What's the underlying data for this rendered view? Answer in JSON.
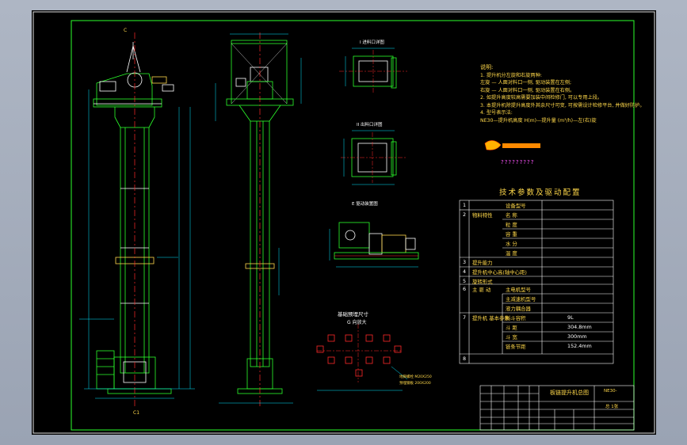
{
  "notes": {
    "title": "说明:",
    "lines": [
      "1. 提升机分左旋和右旋两种:",
      "   左旋 — 人面对料口一侧, 驱动装置在左侧;",
      "   右旋 — 人面对料口一侧, 驱动装置在右侧。",
      "2. 如提升高度较高需要加装中间检修门, 可以专用上段。",
      "3. 本提升机除提升高度外其余尺寸可变, 可按需设计检修平台, 并做好防护。",
      "4. 型号表示法:",
      "   NE30—提升机高度 H(m)—提升量 (m³/h)—左(右)旋"
    ]
  },
  "logo_caption": "?????????",
  "views": {
    "inlet": "I 进料口详图",
    "outlet": "II 出料口详图",
    "drive": "E 驱动装置图",
    "base_title": "基础预埋尺寸",
    "base_sub": "G 向放大",
    "anchor_1": "地脚螺栓 M20X250",
    "anchor_2": "预埋钢板 200X200",
    "section_1": "C",
    "section_2": "C1"
  },
  "param_table": {
    "title": "技术参数及驱动配置",
    "rows": [
      {
        "no": "1",
        "cat": "",
        "item": "设备型号",
        "value": ""
      },
      {
        "no": "2",
        "cat": "物料特性",
        "item": "名 称",
        "value": ""
      },
      {
        "no": "",
        "cat": "",
        "item": "粒 度",
        "value": ""
      },
      {
        "no": "",
        "cat": "",
        "item": "容 重",
        "value": ""
      },
      {
        "no": "",
        "cat": "",
        "item": "水 分",
        "value": ""
      },
      {
        "no": "",
        "cat": "",
        "item": "温 度",
        "value": ""
      },
      {
        "no": "3",
        "cat": "",
        "item": "提升能力",
        "value": ""
      },
      {
        "no": "4",
        "cat": "",
        "item": "提升机中心高(轴中心距)",
        "value": ""
      },
      {
        "no": "5",
        "cat": "",
        "item": "旋转形式",
        "value": ""
      },
      {
        "no": "6",
        "cat": "主 驱 动",
        "item": "主电机型号",
        "value": ""
      },
      {
        "no": "",
        "cat": "",
        "item": "主减速机型号",
        "value": ""
      },
      {
        "no": "",
        "cat": "",
        "item": "液力耦合器",
        "value": ""
      },
      {
        "no": "7",
        "cat": "提升机 基本参数",
        "item": "料斗容积",
        "value": "9L"
      },
      {
        "no": "",
        "cat": "",
        "item": "斗 距",
        "value": "304.8mm"
      },
      {
        "no": "",
        "cat": "",
        "item": "斗 宽",
        "value": "300mm"
      },
      {
        "no": "",
        "cat": "",
        "item": "链条节距",
        "value": "152.4mm"
      },
      {
        "no": "8",
        "cat": "",
        "item": "",
        "value": ""
      }
    ]
  },
  "title_block": {
    "drawing_title": "板链提升机总图",
    "drawing_no": "NE30-",
    "sheet": "总 1张"
  },
  "colors": {
    "frame": "#2bff2b",
    "body": "#2bff2b",
    "dim": "#00e5ff",
    "center": "#ff2a2a",
    "text": "#ffd84a"
  }
}
